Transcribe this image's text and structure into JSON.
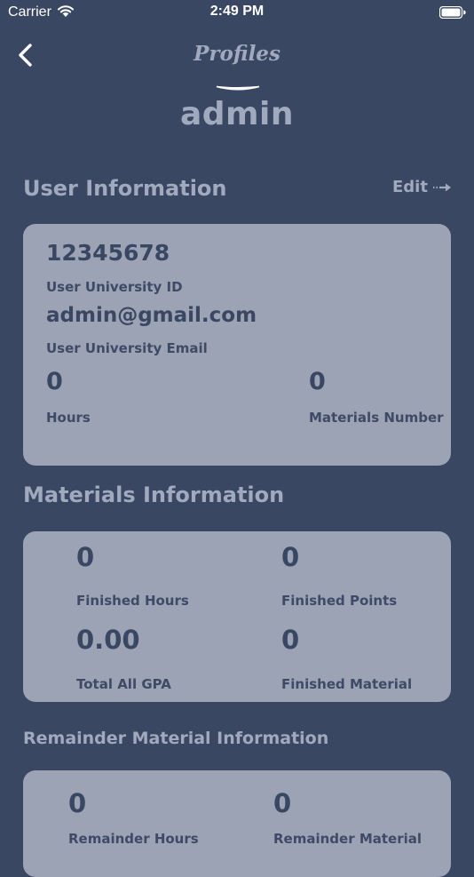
{
  "status_bar": {
    "carrier": "Carrier",
    "time": "2:49 PM"
  },
  "nav": {
    "title": "Profiles"
  },
  "profile": {
    "username": "admin"
  },
  "user_info": {
    "section_title": "User Information",
    "edit_label": "Edit",
    "university_id": "12345678",
    "university_id_label": "User University ID",
    "email": "admin@gmail.com",
    "email_label": "User University Email",
    "hours": "0",
    "hours_label": "Hours",
    "materials_number": "0",
    "materials_number_label": "Materials Number"
  },
  "materials_info": {
    "section_title": "Materials Information",
    "finished_hours": "0",
    "finished_hours_label": "Finished Hours",
    "finished_points": "0",
    "finished_points_label": "Finished Points",
    "total_gpa": "0.00",
    "total_gpa_label": "Total All GPA",
    "finished_material": "0",
    "finished_material_label": "Finished Material"
  },
  "remainder_info": {
    "section_title": "Remainder Material Information",
    "remainder_hours": "0",
    "remainder_hours_label": "Remainder Hours",
    "remainder_material": "0",
    "remainder_material_label": "Remainder Material"
  }
}
